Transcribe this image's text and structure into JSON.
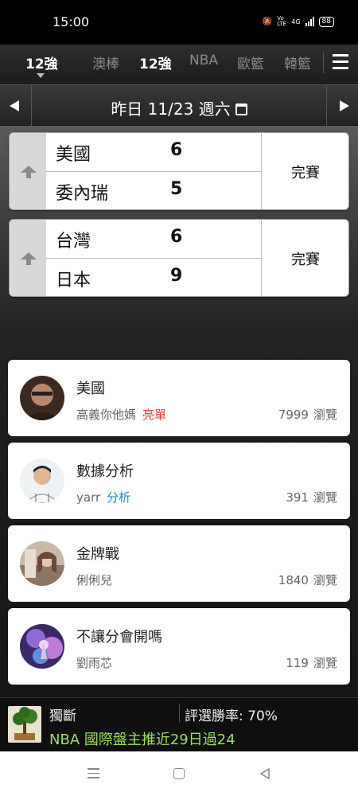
{
  "status_bar": {
    "time": "15:00",
    "network": "4G",
    "volte": "Vo LTE",
    "battery": "88"
  },
  "tabs": {
    "active_group": "12強",
    "items": [
      {
        "label": "澳棒"
      },
      {
        "label": "12強"
      },
      {
        "label": "NBA"
      },
      {
        "label": "歐籃"
      },
      {
        "label": "韓籃"
      }
    ]
  },
  "date_bar": {
    "label": "昨日 11/23 週六"
  },
  "games": [
    {
      "team1": "美國",
      "score1": "6",
      "team2": "委內瑞",
      "score2": "5",
      "status": "完賽"
    },
    {
      "team1": "台灣",
      "score1": "6",
      "team2": "日本",
      "score2": "9",
      "status": "完賽"
    }
  ],
  "posts": [
    {
      "title": "美國",
      "author": "高義你他媽",
      "tag": "亮單",
      "tag_color": "#e53935",
      "views": "7999",
      "views_label": "瀏覽"
    },
    {
      "title": "數據分析",
      "author": "yarr",
      "tag": "分析",
      "tag_color": "#1e88c9",
      "views": "391",
      "views_label": "瀏覽"
    },
    {
      "title": "金牌戰",
      "author": "俐俐兒",
      "tag": "",
      "tag_color": "",
      "views": "1840",
      "views_label": "瀏覽"
    },
    {
      "title": "不讓分會開嗎",
      "author": "劉雨芯",
      "tag": "",
      "tag_color": "",
      "views": "119",
      "views_label": "瀏覽"
    }
  ],
  "banner": {
    "label": "獨斷",
    "rate": "評選勝率: 70%",
    "headline": "NBA 國際盤主推近29日過24"
  }
}
